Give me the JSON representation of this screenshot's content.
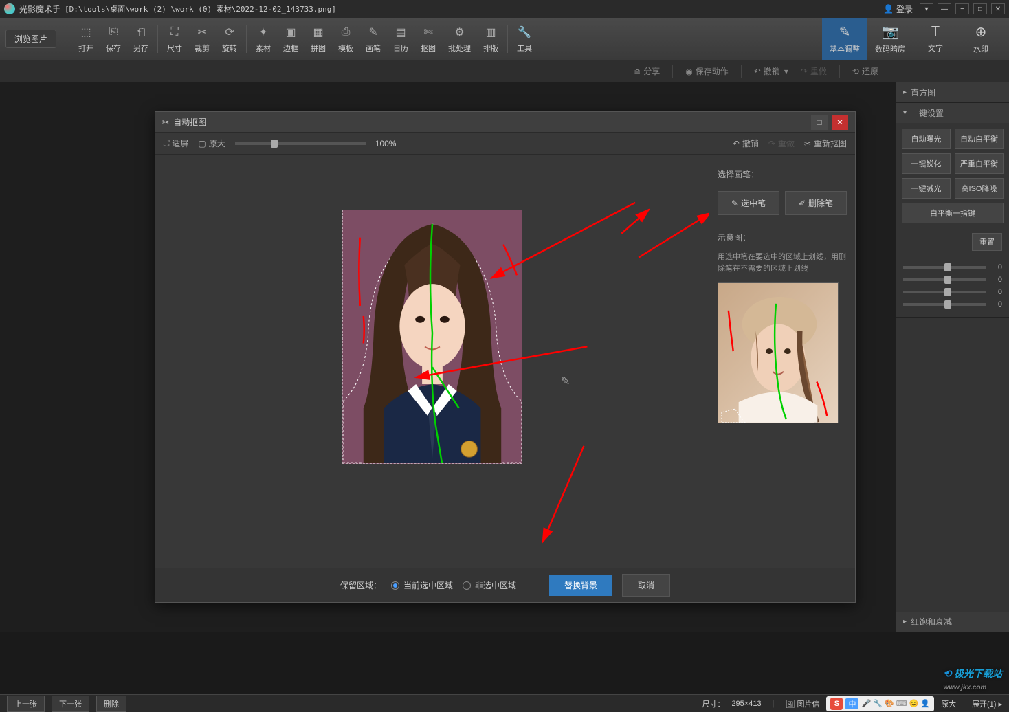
{
  "titlebar": {
    "app_name": "光影魔术手",
    "file_path": "[D:\\tools\\桌面\\work (2) \\work (0) 素材\\2022-12-02_143733.png]",
    "login": "登录"
  },
  "toolbar": {
    "browse": "浏览图片",
    "items": [
      "打开",
      "保存",
      "另存",
      "尺寸",
      "裁剪",
      "旋转",
      "素材",
      "边框",
      "拼图",
      "模板",
      "画笔",
      "日历",
      "抠图",
      "批处理",
      "排版",
      "工具"
    ],
    "right_tabs": [
      "基本调整",
      "数码暗房",
      "文字",
      "水印"
    ],
    "active_tab_index": 0
  },
  "secondbar": {
    "share": "分享",
    "save_action": "保存动作",
    "undo": "撤销",
    "redo": "重做",
    "restore": "还原"
  },
  "panel": {
    "histogram": "直方图",
    "quick_settings": "一键设置",
    "buttons": [
      "自动曝光",
      "自动白平衡",
      "一键锐化",
      "严重白平衡",
      "一键减光",
      "高ISO降噪",
      "白平衡一指键"
    ],
    "reset": "重置",
    "slider_vals": [
      "0",
      "0",
      "0",
      "0"
    ],
    "red_sat": "红饱和衰减"
  },
  "modal": {
    "title": "自动抠图",
    "fit": "适屏",
    "original": "原大",
    "zoom": "100%",
    "undo": "撤销",
    "redo": "重做",
    "recut": "重新抠图",
    "select_brush_label": "选择画笔：",
    "select_pen": "选中笔",
    "delete_pen": "删除笔",
    "example_label": "示意图：",
    "help_text": "用选中笔在要选中的区域上划线，用删除笔在不需要的区域上划线",
    "keep_area": "保留区域：",
    "current_selected": "当前选中区域",
    "not_selected": "非选中区域",
    "replace_bg": "替换背景",
    "cancel": "取消"
  },
  "statusbar": {
    "prev": "上一张",
    "next": "下一张",
    "delete": "删除",
    "size_label": "尺寸：",
    "size_value": "295×413",
    "img_info": "图片信",
    "original": "原大",
    "expand": "展开(1)",
    "ime": "中"
  },
  "watermark": "极光下载站"
}
